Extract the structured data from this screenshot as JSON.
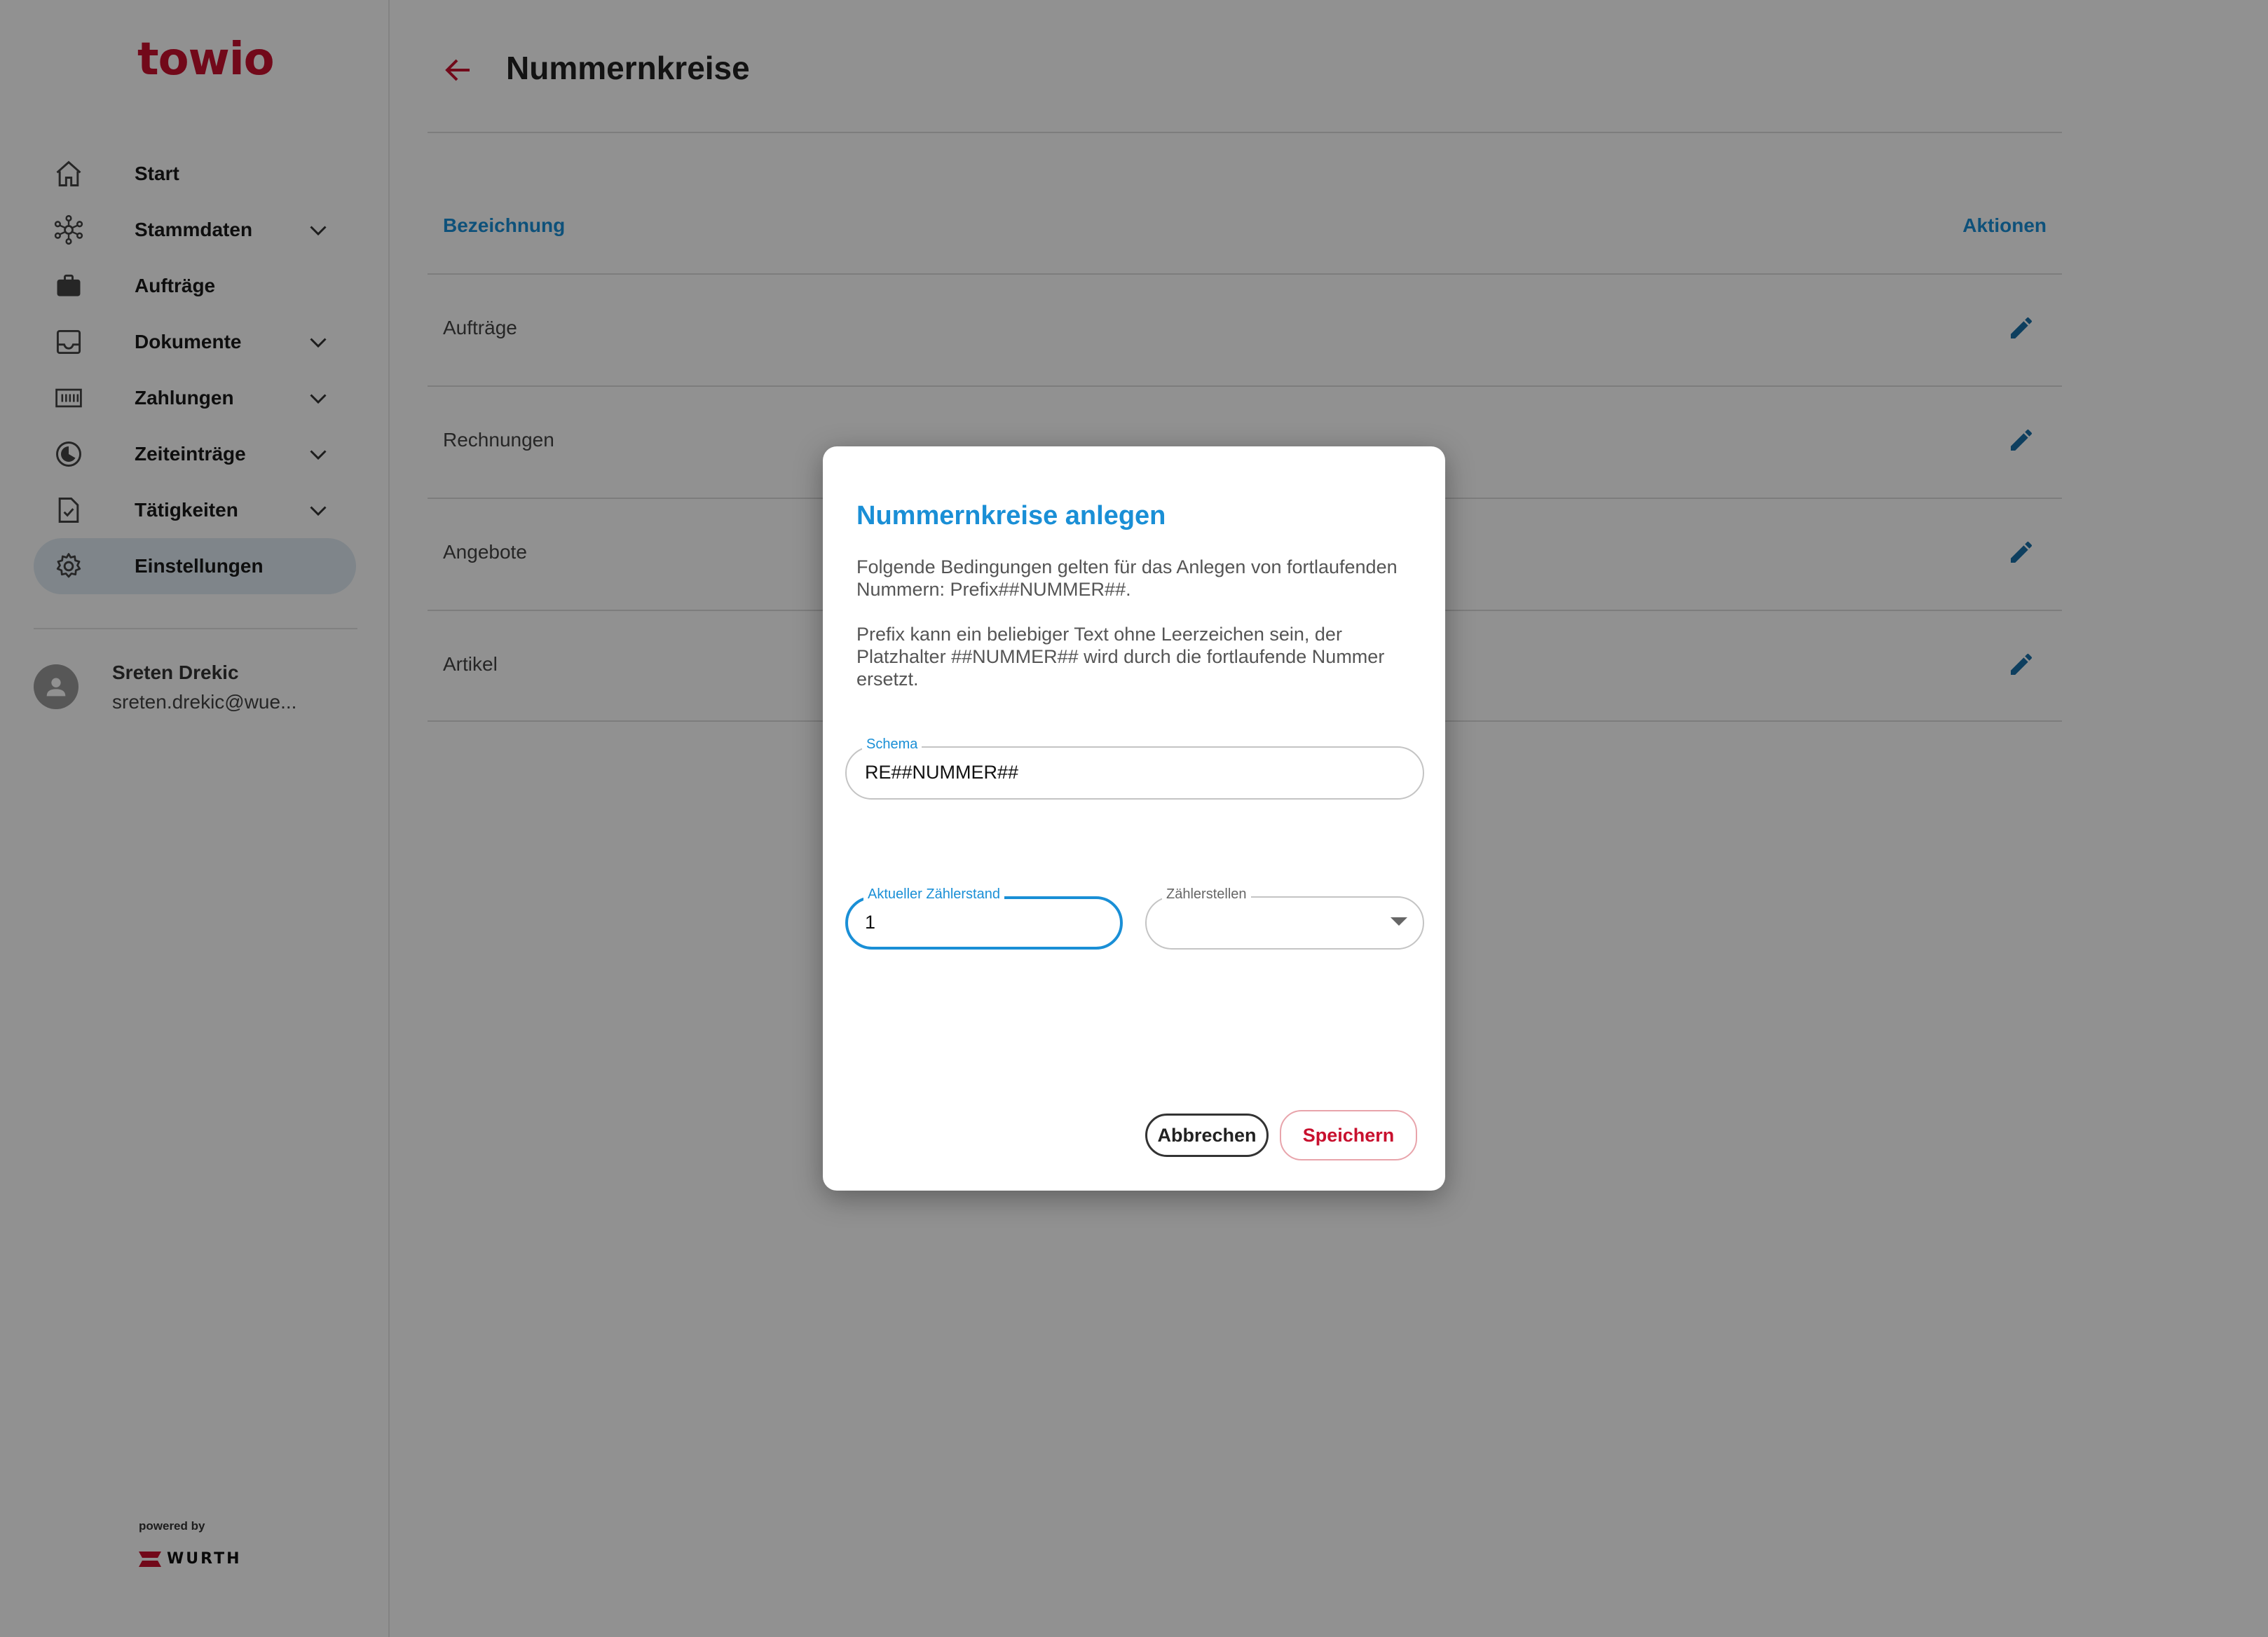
{
  "brand": {
    "logo": "towio",
    "powered_by": "powered by",
    "partner": "WURTH"
  },
  "sidebar": {
    "items": [
      {
        "label": "Start",
        "icon": "home-icon",
        "expandable": false
      },
      {
        "label": "Stammdaten",
        "icon": "network-icon",
        "expandable": true
      },
      {
        "label": "Aufträge",
        "icon": "briefcase-icon",
        "expandable": false
      },
      {
        "label": "Dokumente",
        "icon": "inbox-icon",
        "expandable": true
      },
      {
        "label": "Zahlungen",
        "icon": "payments-icon",
        "expandable": true
      },
      {
        "label": "Zeiteinträge",
        "icon": "clock-icon",
        "expandable": true
      },
      {
        "label": "Tätigkeiten",
        "icon": "task-icon",
        "expandable": true
      },
      {
        "label": "Einstellungen",
        "icon": "gear-icon",
        "expandable": false,
        "active": true
      }
    ],
    "user": {
      "name": "Sreten Drekic",
      "email": "sreten.drekic@wue..."
    }
  },
  "main": {
    "title": "Nummernkreise",
    "table": {
      "headers": {
        "name": "Bezeichnung",
        "actions": "Aktionen"
      },
      "rows": [
        {
          "label": "Aufträge"
        },
        {
          "label": "Rechnungen"
        },
        {
          "label": "Angebote"
        },
        {
          "label": "Artikel"
        }
      ]
    }
  },
  "dialog": {
    "title": "Nummernkreise anlegen",
    "text1": "Folgende Bedingungen gelten für das Anlegen von fortlaufenden Nummern: Prefix##NUMMER##.",
    "text2": "Prefix kann ein beliebiger Text ohne Leerzeichen sein, der Platzhalter ##NUMMER## wird durch die fortlaufende Nummer ersetzt.",
    "schema": {
      "label": "Schema",
      "value": "RE##NUMMER##"
    },
    "counter": {
      "label": "Aktueller Zählerstand",
      "value": "1"
    },
    "digits": {
      "label": "Zählerstellen",
      "value": ""
    },
    "cancel_label": "Abbrechen",
    "save_label": "Speichern"
  },
  "colors": {
    "accent": "#1a8fd6",
    "brand": "#c8102e",
    "active_bg": "#dfeaf2"
  }
}
